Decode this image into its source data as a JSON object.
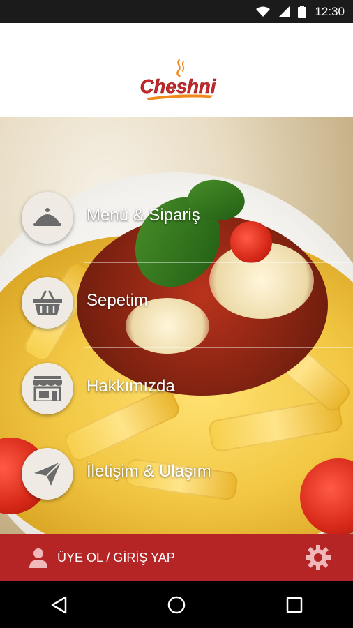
{
  "status_bar": {
    "time": "12:30",
    "icons": [
      "wifi-icon",
      "signal-icon",
      "battery-icon"
    ]
  },
  "header": {
    "logo_text": "Cheshni"
  },
  "menu": {
    "items": [
      {
        "label": "Menü & Sipariş",
        "icon": "cloche-icon"
      },
      {
        "label": "Sepetim",
        "icon": "basket-icon"
      },
      {
        "label": "Hakkımızda",
        "icon": "store-icon"
      },
      {
        "label": "İletişim & Ulaşım",
        "icon": "paper-plane-icon"
      }
    ]
  },
  "bottom_bar": {
    "login_label": "ÜYE OL / GİRİŞ YAP",
    "settings_icon": "gear-icon"
  },
  "nav_bar": {
    "buttons": [
      "back-icon",
      "home-icon",
      "recents-icon"
    ]
  },
  "colors": {
    "accent": "#b62525",
    "logo_red": "#c7282a",
    "logo_orange": "#f08a1c",
    "header_bg": "#ffffff"
  }
}
